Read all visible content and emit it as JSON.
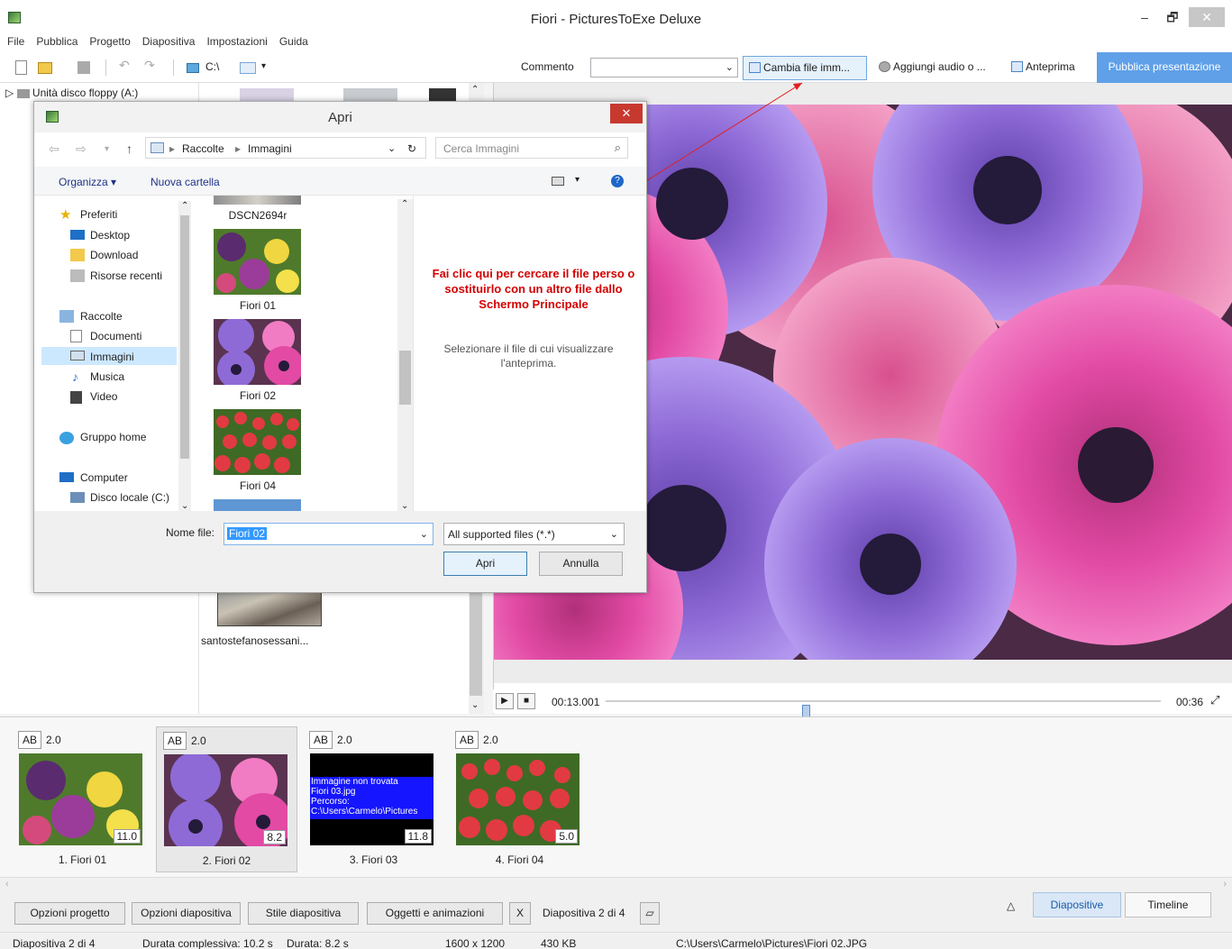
{
  "window": {
    "title": "Fiori - PicturesToExe Deluxe",
    "min": "–",
    "max": "🗗",
    "close": "✕"
  },
  "menu": [
    "File",
    "Pubblica",
    "Progetto",
    "Diapositiva",
    "Impostazioni",
    "Guida"
  ],
  "toolbar": {
    "drive_label": "C:\\",
    "comment_label": "Commento",
    "change_file": "Cambia file imm...",
    "add_audio": "Aggiungi audio o ...",
    "preview": "Anteprima",
    "publish": "Pubblica presentazione"
  },
  "tree": {
    "floppy": "Unità disco floppy (A:)"
  },
  "files_bg": {
    "item_label": "santostefanosessani..."
  },
  "player": {
    "current_time": "00:13.001",
    "total_time": "00:36",
    "position_fraction": 0.36
  },
  "slides": [
    {
      "tag": "AB",
      "transition": "2.0",
      "duration": "11.0",
      "name": "1. Fiori 01"
    },
    {
      "tag": "AB",
      "transition": "2.0",
      "duration": "8.2",
      "name": "2. Fiori 02"
    },
    {
      "tag": "AB",
      "transition": "2.0",
      "duration": "11.8",
      "name": "3. Fiori 03",
      "missing": [
        "Immagine non trovata",
        "Fiori 03.jpg",
        "Percorso:",
        "C:\\Users\\Carmelo\\Pictures"
      ]
    },
    {
      "tag": "AB",
      "transition": "2.0",
      "duration": "5.0",
      "name": "4. Fiori 04"
    }
  ],
  "bottombar": {
    "project_options": "Opzioni progetto",
    "slide_options": "Opzioni diapositiva",
    "slide_style": "Stile diapositiva",
    "objects": "Oggetti e animazioni",
    "x": "X",
    "slide_counter": "Diapositiva 2 di 4",
    "tab_slides": "Diapositive",
    "tab_timeline": "Timeline"
  },
  "status": {
    "slide": "Diapositiva 2 di 4",
    "total_duration": "Durata complessiva: 10.2 s",
    "duration": "Durata: 8.2 s",
    "resolution": "1600 x 1200",
    "size": "430 KB",
    "path": "C:\\Users\\Carmelo\\Pictures\\Fiori 02.JPG"
  },
  "dialog": {
    "title": "Apri",
    "close": "✕",
    "address": [
      "Raccolte",
      "Immagini"
    ],
    "search_placeholder": "Cerca Immagini",
    "organize": "Organizza ▾",
    "new_folder": "Nuova cartella",
    "nav": {
      "favorites": "Preferiti",
      "desktop": "Desktop",
      "download": "Download",
      "recent": "Risorse recenti",
      "libraries": "Raccolte",
      "documents": "Documenti",
      "images": "Immagini",
      "music": "Musica",
      "video": "Video",
      "homegroup": "Gruppo home",
      "computer": "Computer",
      "local_disk": "Disco locale (C:)"
    },
    "files": [
      "DSCN2694r",
      "Fiori 01",
      "Fiori 02",
      "Fiori 04"
    ],
    "annotation": "Fai clic qui per cercare il file perso o sostituirlo con un altro file dallo Schermo Principale",
    "preview_message": "Selezionare il file di cui visualizzare l'anteprima.",
    "filename_label": "Nome file:",
    "filename_value": "Fiori 02",
    "filetype": "All supported files (*.*)",
    "open": "Apri",
    "cancel": "Annulla"
  },
  "colors": {
    "accent": "#5fa0e8",
    "annotation": "#d40000",
    "missing_bg": "#1515ff"
  }
}
